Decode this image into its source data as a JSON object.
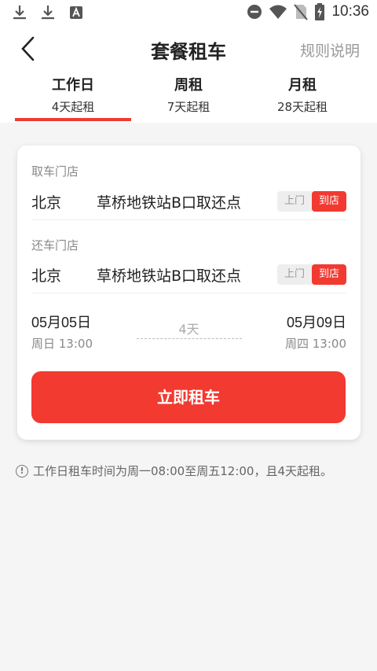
{
  "status_bar": {
    "time": "10:36",
    "left_icons": [
      "download-icon",
      "download-icon",
      "app-a-icon"
    ],
    "right_icons": [
      "do-not-disturb-icon",
      "wifi-icon",
      "no-sim-icon",
      "battery-charging-icon"
    ]
  },
  "header": {
    "title": "套餐租车",
    "rules_link": "规则说明"
  },
  "tabs": [
    {
      "name": "工作日",
      "sub": "4天起租",
      "active": true
    },
    {
      "name": "周租",
      "sub": "7天起租",
      "active": false
    },
    {
      "name": "月租",
      "sub": "28天起租",
      "active": false
    }
  ],
  "pickup": {
    "label": "取车门店",
    "city": "北京",
    "store": "草桥地铁站B口取还点",
    "mode_door": "上门",
    "mode_store": "到店",
    "selected_mode": "到店"
  },
  "return": {
    "label": "还车门店",
    "city": "北京",
    "store": "草桥地铁站B口取还点",
    "mode_door": "上门",
    "mode_store": "到店",
    "selected_mode": "到店"
  },
  "schedule": {
    "start_date": "05月05日",
    "start_time": "周日 13:00",
    "duration": "4天",
    "end_date": "05月09日",
    "end_time": "周四 13:00"
  },
  "rent_button": "立即租车",
  "notice": "工作日租车时间为周一08:00至周五12:00，且4天起租。",
  "colors": {
    "accent": "#f23a30",
    "background": "#f5f5f5",
    "muted_text": "#888888"
  }
}
